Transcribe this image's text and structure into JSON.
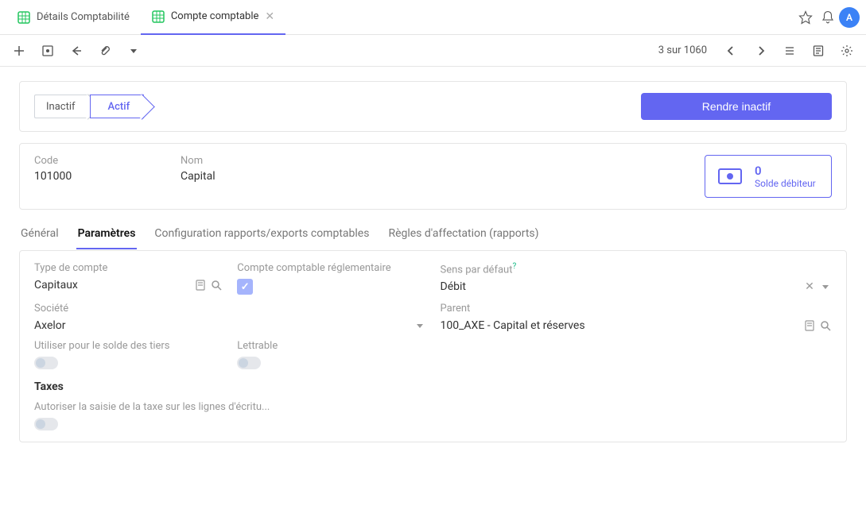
{
  "header": {
    "tabs": [
      {
        "label": "Détails Comptabilité",
        "active": false
      },
      {
        "label": "Compte comptable",
        "active": true
      }
    ],
    "avatar_letter": "A"
  },
  "toolbar": {
    "record_position": "3 sur 1060"
  },
  "status": {
    "inactive_label": "Inactif",
    "active_label": "Actif",
    "action_button": "Rendre inactif"
  },
  "summary": {
    "code_label": "Code",
    "code_value": "101000",
    "nom_label": "Nom",
    "nom_value": "Capital",
    "balance_amount": "0",
    "balance_desc": "Solde débiteur"
  },
  "subtabs": {
    "general": "Général",
    "parametres": "Paramètres",
    "config": "Configuration rapports/exports comptables",
    "regles": "Règles d'affectation (rapports)"
  },
  "params": {
    "type_label": "Type de compte",
    "type_value": "Capitaux",
    "compte_reg_label": "Compte comptable réglementaire",
    "sens_label": "Sens par défaut",
    "sens_value": "Débit",
    "societe_label": "Société",
    "societe_value": "Axelor",
    "parent_label": "Parent",
    "parent_value": "100_AXE - Capital et réserves",
    "utiliser_label": "Utiliser pour le solde des tiers",
    "lettrable_label": "Lettrable",
    "taxes_heading": "Taxes",
    "autoriser_label": "Autoriser la saisie de la taxe sur les lignes d'écritu..."
  }
}
